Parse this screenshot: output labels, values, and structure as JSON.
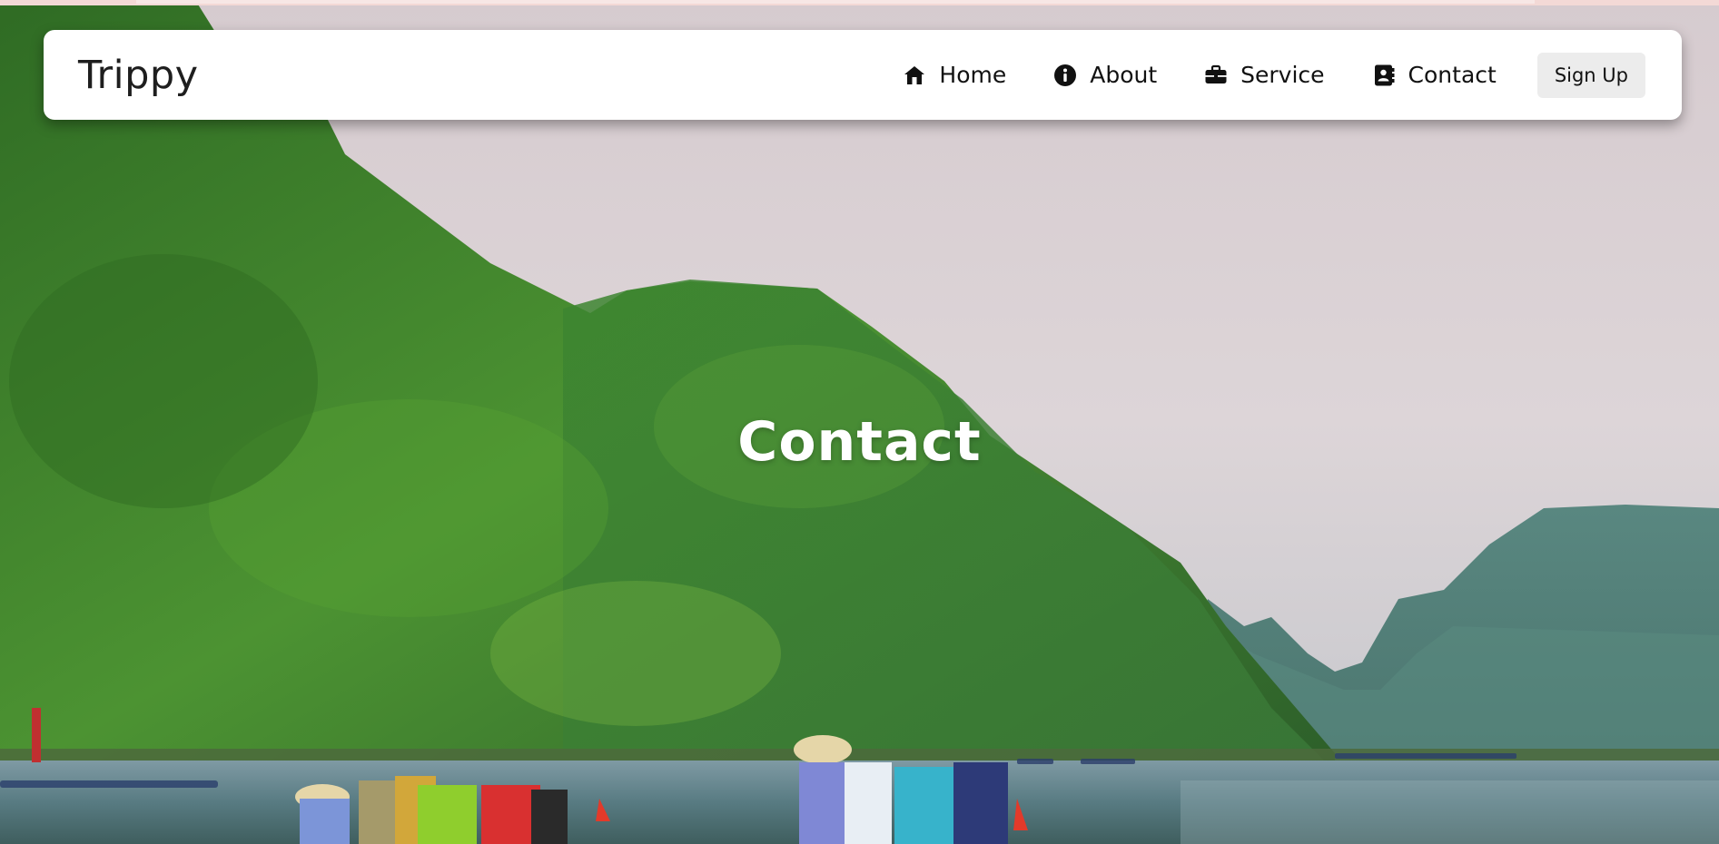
{
  "brand": "Trippy",
  "nav": {
    "items": [
      {
        "label": "Home",
        "icon": "home-icon"
      },
      {
        "label": "About",
        "icon": "info-icon"
      },
      {
        "label": "Service",
        "icon": "briefcase-icon"
      },
      {
        "label": "Contact",
        "icon": "contact-book-icon"
      }
    ],
    "signup_label": "Sign Up"
  },
  "hero": {
    "title": "Contact",
    "image": "river-valley-with-green-mountains-and-boats"
  },
  "colors": {
    "navbar_bg": "#ffffff",
    "signup_bg": "#ececec",
    "title_text": "#ffffff",
    "foliage": "#3f8a2c",
    "water": "#5f7d87"
  }
}
